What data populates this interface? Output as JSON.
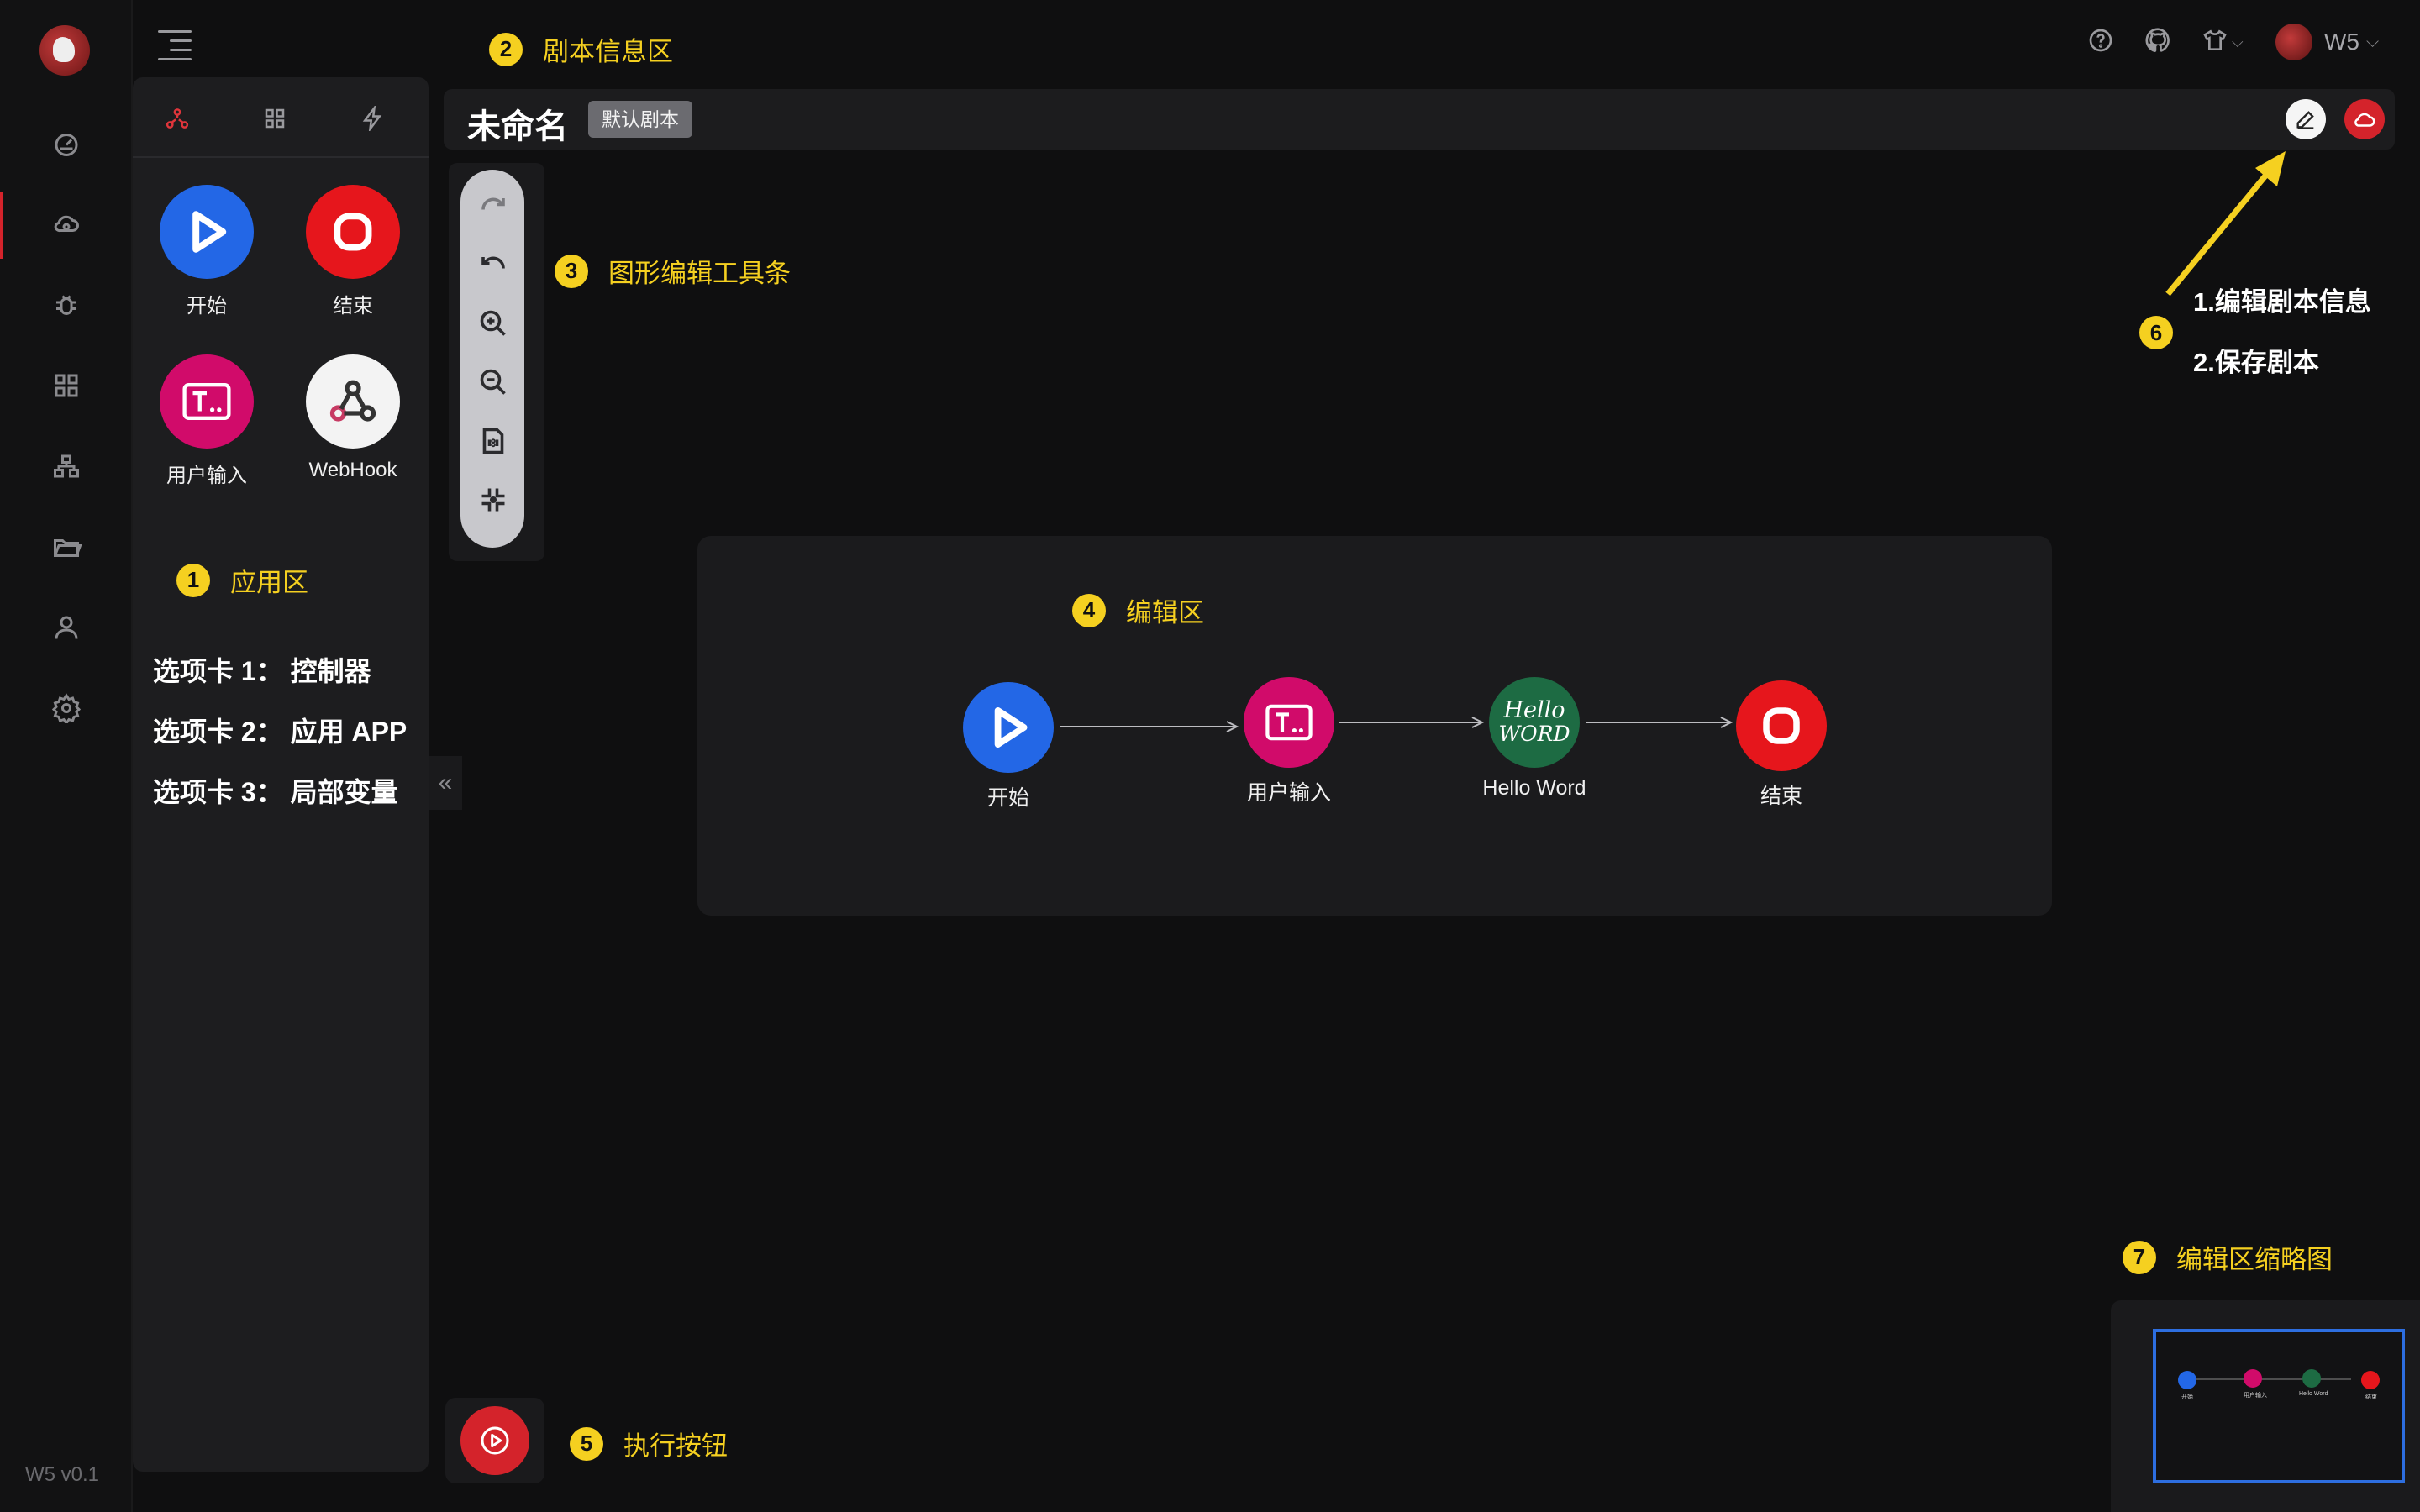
{
  "rail": {
    "version": "W5 v0.1",
    "items": [
      "dashboard-icon",
      "cloud-icon",
      "bug-icon",
      "grid-icon",
      "sitemap-icon",
      "folder-icon",
      "user-icon",
      "settings-icon"
    ]
  },
  "topbar": {
    "user_name": "W5",
    "icons": [
      "help-icon",
      "github-icon",
      "theme-icon"
    ]
  },
  "panel": {
    "tabs": [
      "controller-tab",
      "apps-tab",
      "variables-tab"
    ],
    "apps": [
      {
        "label": "开始",
        "color": "#2367e6",
        "icon": "play-icon"
      },
      {
        "label": "结束",
        "color": "#e6161c",
        "icon": "stop-icon"
      },
      {
        "label": "用户输入",
        "color": "#d10b6a",
        "icon": "text-input-icon"
      },
      {
        "label": "WebHook",
        "color": "#f3f3f3",
        "icon": "webhook-icon"
      }
    ],
    "collapse_glyph": "«"
  },
  "script": {
    "title": "未命名",
    "tag": "默认剧本"
  },
  "flow": {
    "nodes": [
      {
        "label": "开始",
        "color": "#2367e6"
      },
      {
        "label": "用户输入",
        "color": "#d10b6a"
      },
      {
        "label": "Hello Word",
        "color": "#1d6b43",
        "text1": "Hello",
        "text2": "WORD"
      },
      {
        "label": "结束",
        "color": "#e6161c"
      }
    ]
  },
  "annotations": {
    "a1": {
      "num": "1",
      "text": "应用区"
    },
    "a2": {
      "num": "2",
      "text": "剧本信息区"
    },
    "a3": {
      "num": "3",
      "text": "图形编辑工具条"
    },
    "a4": {
      "num": "4",
      "text": "编辑区"
    },
    "a5": {
      "num": "5",
      "text": "执行按钮"
    },
    "a6": {
      "num": "6"
    },
    "a7": {
      "num": "7",
      "text": "编辑区缩略图"
    },
    "note6_line1": "1.编辑剧本信息",
    "note6_line2": "2.保存剧本",
    "tab_desc": [
      "选项卡 1： 控制器",
      "选项卡 2： 应用 APP",
      "选项卡 3： 局部变量"
    ]
  },
  "minimap": {
    "labels": [
      "开始",
      "用户输入",
      "Hello Word",
      "结束"
    ]
  },
  "colors": {
    "accent_red": "#d4232b",
    "annotation_yellow": "#f5d020",
    "minimap_border": "#2d6ee0"
  }
}
